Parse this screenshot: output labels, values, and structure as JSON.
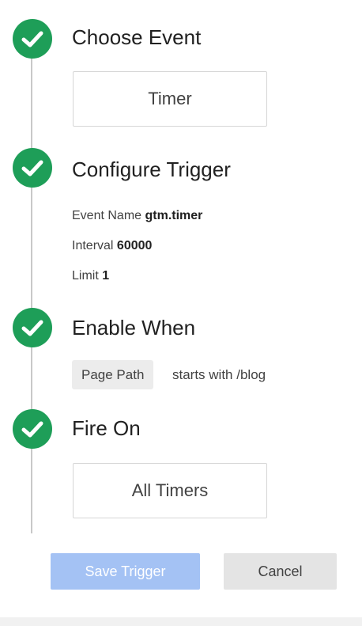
{
  "steps": {
    "choose_event": {
      "title": "Choose Event",
      "value": "Timer"
    },
    "configure_trigger": {
      "title": "Configure Trigger",
      "event_name_label": "Event Name",
      "event_name_value": "gtm.timer",
      "interval_label": "Interval",
      "interval_value": "60000",
      "limit_label": "Limit",
      "limit_value": "1"
    },
    "enable_when": {
      "title": "Enable When",
      "variable": "Page Path",
      "condition": "starts with /blog"
    },
    "fire_on": {
      "title": "Fire On",
      "value": "All Timers"
    }
  },
  "buttons": {
    "save_label": "Save Trigger",
    "cancel_label": "Cancel"
  },
  "icons": {
    "step_status": "check-circle-icon"
  },
  "colors": {
    "check_green": "#1e9e58",
    "primary_disabled": "#a4c2f4",
    "secondary_bg": "#e4e4e4"
  }
}
